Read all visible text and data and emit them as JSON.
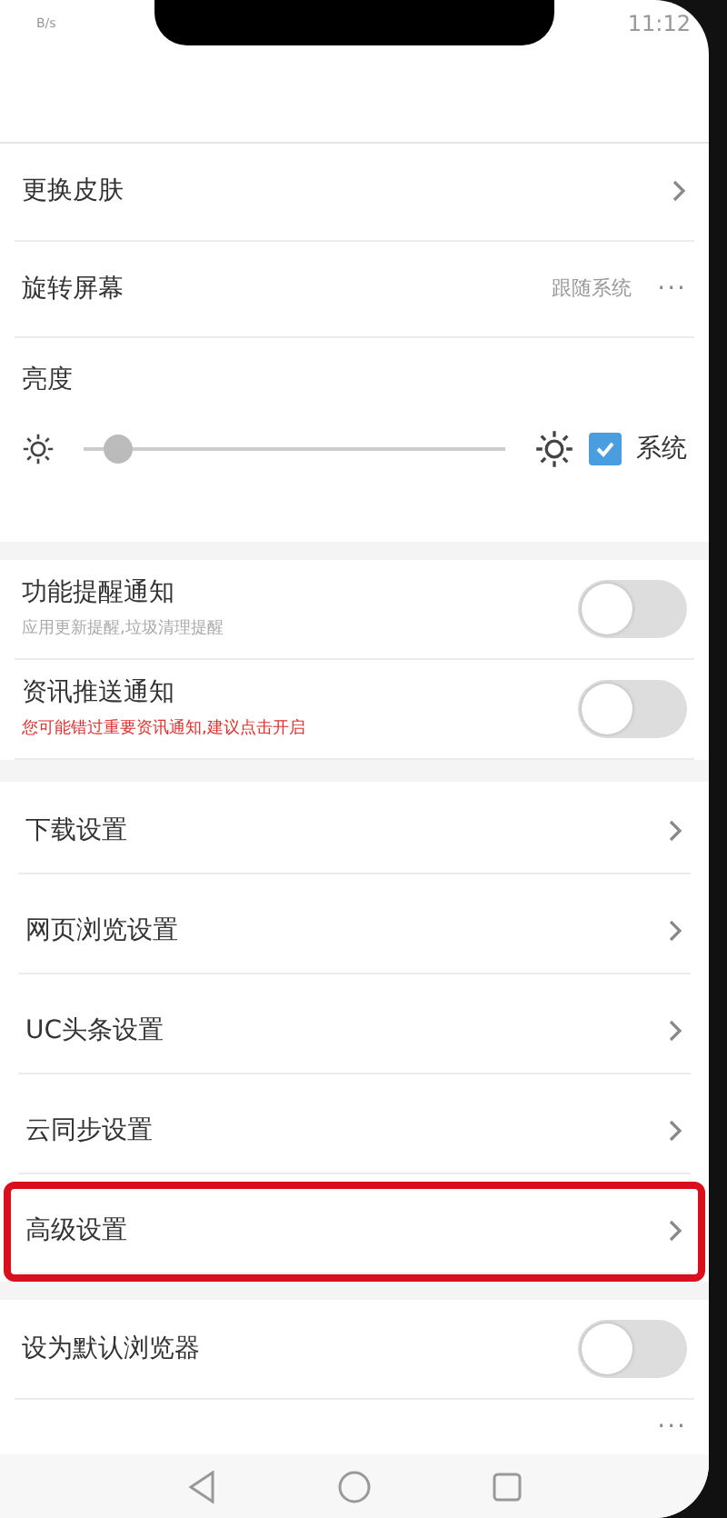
{
  "status_bar": {
    "network_speed": "B/s",
    "time": "11:12"
  },
  "display": [
    {
      "kind": "link",
      "label": "更换皮肤"
    },
    {
      "kind": "option",
      "label": "旋转屏幕",
      "value": "跟随系统",
      "more": "···"
    }
  ],
  "brightness": {
    "label": "亮度",
    "level": 0.08,
    "system": {
      "label": "系统",
      "checked": true
    }
  },
  "notifications": [
    {
      "label": "功能提醒通知",
      "hint": "应用更新提醒,垃圾清理提醒",
      "warning": false,
      "on": false
    },
    {
      "label": "资讯推送通知",
      "hint": "您可能错过重要资讯通知,建议点击开启",
      "warning": true,
      "on": false
    }
  ],
  "settings": [
    {
      "label": "下载设置",
      "highlighted": false
    },
    {
      "label": "网页浏览设置",
      "highlighted": false
    },
    {
      "label": "UC头条设置",
      "highlighted": false
    },
    {
      "label": "云同步设置",
      "highlighted": false
    },
    {
      "label": "高级设置",
      "highlighted": true
    }
  ],
  "default_browser": {
    "label": "设为默认浏览器",
    "on": false
  },
  "partial_row": {
    "more": "···"
  }
}
